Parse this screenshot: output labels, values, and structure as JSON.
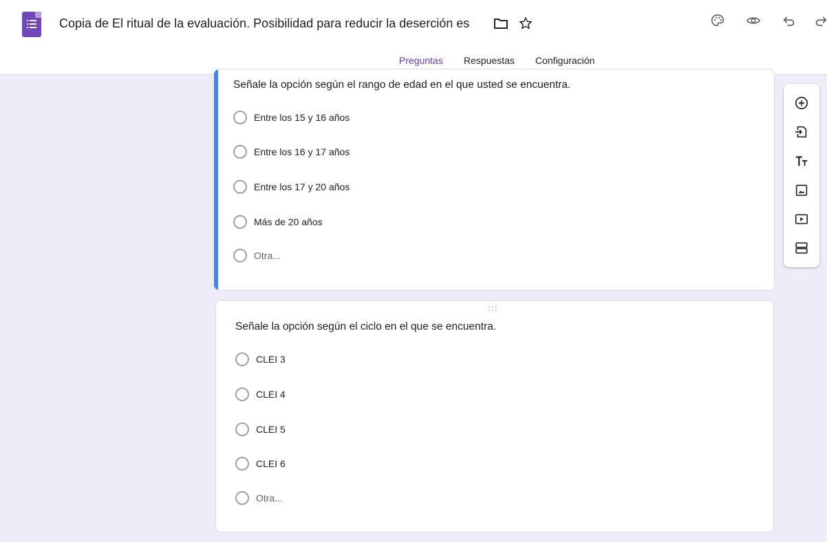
{
  "header": {
    "doc_title": "Copia de El ritual de la evaluación. Posibilidad para reducir la deserción es",
    "title_icons": [
      "folder-icon",
      "star-icon"
    ],
    "actions": [
      "palette-icon",
      "eye-icon",
      "undo-icon",
      "redo-icon"
    ]
  },
  "tabs": [
    {
      "label": "Preguntas",
      "active": true
    },
    {
      "label": "Respuestas",
      "active": false
    },
    {
      "label": "Configuración",
      "active": false
    }
  ],
  "questions": [
    {
      "title": "Señale la opción según el rango de edad en el que usted se encuentra.",
      "options": [
        "Entre los 15 y 16 años",
        "Entre los 16 y 17 años",
        "Entre los 17 y 20 años",
        "Más de 20 años"
      ],
      "other": "Otra..."
    },
    {
      "title": "Señale la opción según el ciclo en el que se encuentra.",
      "options": [
        "CLEI 3",
        "CLEI 4",
        "CLEI 5",
        "CLEI 6"
      ],
      "other": "Otra..."
    }
  ],
  "toolbar": [
    "add-question-icon",
    "import-questions-icon",
    "add-title-icon",
    "add-image-icon",
    "add-video-icon",
    "add-section-icon"
  ],
  "colors": {
    "accent": "#673ab7",
    "active_card": "#4285f4",
    "background": "#f0ebf8"
  }
}
